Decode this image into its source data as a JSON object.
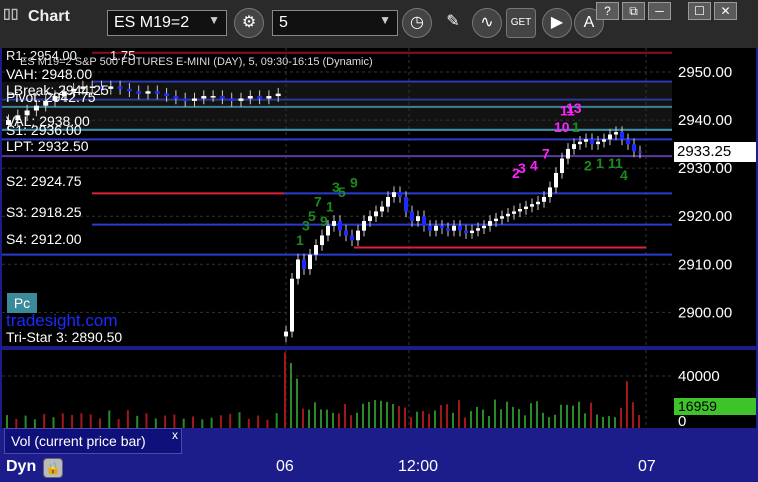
{
  "toolbar": {
    "app_title": "Chart",
    "symbol": "ES M19=2",
    "interval": "5",
    "get_label": "GET",
    "alert_label": "A"
  },
  "window_controls": {
    "help": "?",
    "restore": "⧉",
    "minimize": "─",
    "maximize": "☐",
    "close": "✕"
  },
  "price_header": "ES M19=2 S&P 500 FUTURES E-MINI (DAY), 5, 09:30-16:15 (Dynamic)",
  "levels": {
    "r1": "R1: 2954.00",
    "r1_extra": "1.75",
    "vah": "VAH: 2948.00",
    "lbreak": "LBreak: 2944.25",
    "pivot": "Pivot: 2942.75",
    "val": "VAL: 2938.00",
    "s1": "S1: 2936.00",
    "lpt": "LPT: 2932.50",
    "s2": "S2: 2924.75",
    "s3": "S3: 2918.25",
    "s4": "S4: 2912.00",
    "tristar": "Tri-Star 3: 2890.50"
  },
  "pc_label": "Pc",
  "watermark": "tradesight.com",
  "price_axis": [
    "2950.00",
    "2940.00",
    "2930.00",
    "2920.00",
    "2910.00",
    "2900.00"
  ],
  "current_price": "2933.25",
  "volume_axis": [
    "40000",
    "0"
  ],
  "current_volume": "16959",
  "volume_caption": "Vol (current price bar)",
  "volume_close": "x",
  "time_axis": [
    "06",
    "12:00",
    "07"
  ],
  "dyn_label": "Dyn",
  "chart_data": {
    "type": "candlestick",
    "price_ylim": [
      2893,
      2955
    ],
    "price_ticks": [
      2950,
      2940,
      2930,
      2920,
      2910,
      2900
    ],
    "prev_session_closes": [
      2940,
      2941,
      2942,
      2943,
      2944,
      2945,
      2946,
      2946.5,
      2947,
      2947,
      2946.5,
      2947,
      2946.5,
      2946,
      2945.5,
      2946,
      2945.5,
      2945,
      2944.5,
      2944,
      2944.5,
      2945,
      2945,
      2944.5,
      2944,
      2944.5,
      2945,
      2944.5,
      2945,
      2945.5
    ],
    "session_closes": [
      2896,
      2907,
      2911,
      2909,
      2912,
      2914,
      2916,
      2918,
      2919,
      2917,
      2916,
      2915,
      2917,
      2919,
      2920,
      2921,
      2922,
      2924,
      2925,
      2924,
      2921,
      2919,
      2920,
      2918,
      2917,
      2918,
      2917.5,
      2917,
      2918,
      2917,
      2916.5,
      2917,
      2917.5,
      2918,
      2919,
      2919.5,
      2920,
      2920.5,
      2921,
      2921.5,
      2922,
      2922.5,
      2923,
      2924,
      2926,
      2929,
      2932,
      2934,
      2935,
      2935.5,
      2936,
      2935,
      2935.5,
      2936,
      2937,
      2937.5,
      2936,
      2935,
      2933.5,
      2933.25
    ],
    "volume_ylim": [
      0,
      60000
    ],
    "volume_ticks": [
      40000,
      0
    ]
  },
  "colors": {
    "up_bar": "#ffffff",
    "down_bar": "#1e2bff",
    "support_line": "#e0203a",
    "level_line": "#2a3bd0",
    "setup_green": "#1d8a1d",
    "setup_magenta": "#ff22ff",
    "vol_green": "#2a8a2a",
    "vol_red": "#a01818"
  },
  "td_labels": [
    {
      "text": "1",
      "bar": 2,
      "price": 2914,
      "color": "green"
    },
    {
      "text": "3",
      "bar": 3,
      "price": 2917,
      "color": "green"
    },
    {
      "text": "5",
      "bar": 4,
      "price": 2919,
      "color": "green"
    },
    {
      "text": "7",
      "bar": 5,
      "price": 2922,
      "color": "green"
    },
    {
      "text": "9",
      "bar": 6,
      "price": 2918,
      "color": "green"
    },
    {
      "text": "1",
      "bar": 7,
      "price": 2921,
      "color": "green"
    },
    {
      "text": "3",
      "bar": 8,
      "price": 2925,
      "color": "green"
    },
    {
      "text": "5",
      "bar": 9,
      "price": 2924,
      "color": "green"
    },
    {
      "text": "9",
      "bar": 11,
      "price": 2926,
      "color": "green"
    },
    {
      "text": "2",
      "bar": 38,
      "price": 2928,
      "color": "magenta"
    },
    {
      "text": "3",
      "bar": 39,
      "price": 2929,
      "color": "magenta"
    },
    {
      "text": "4",
      "bar": 41,
      "price": 2929.5,
      "color": "magenta"
    },
    {
      "text": "7",
      "bar": 43,
      "price": 2932,
      "color": "magenta"
    },
    {
      "text": "10",
      "bar": 45,
      "price": 2937.5,
      "color": "magenta"
    },
    {
      "text": "11",
      "bar": 46,
      "price": 2941,
      "color": "magenta"
    },
    {
      "text": "13",
      "bar": 47,
      "price": 2941.5,
      "color": "magenta"
    },
    {
      "text": "1",
      "bar": 48,
      "price": 2937.5,
      "color": "green"
    },
    {
      "text": "2",
      "bar": 50,
      "price": 2929.5,
      "color": "green"
    },
    {
      "text": "1",
      "bar": 52,
      "price": 2930,
      "color": "green"
    },
    {
      "text": "11",
      "bar": 54,
      "price": 2930,
      "color": "green"
    },
    {
      "text": "4",
      "bar": 56,
      "price": 2927.5,
      "color": "green"
    }
  ]
}
